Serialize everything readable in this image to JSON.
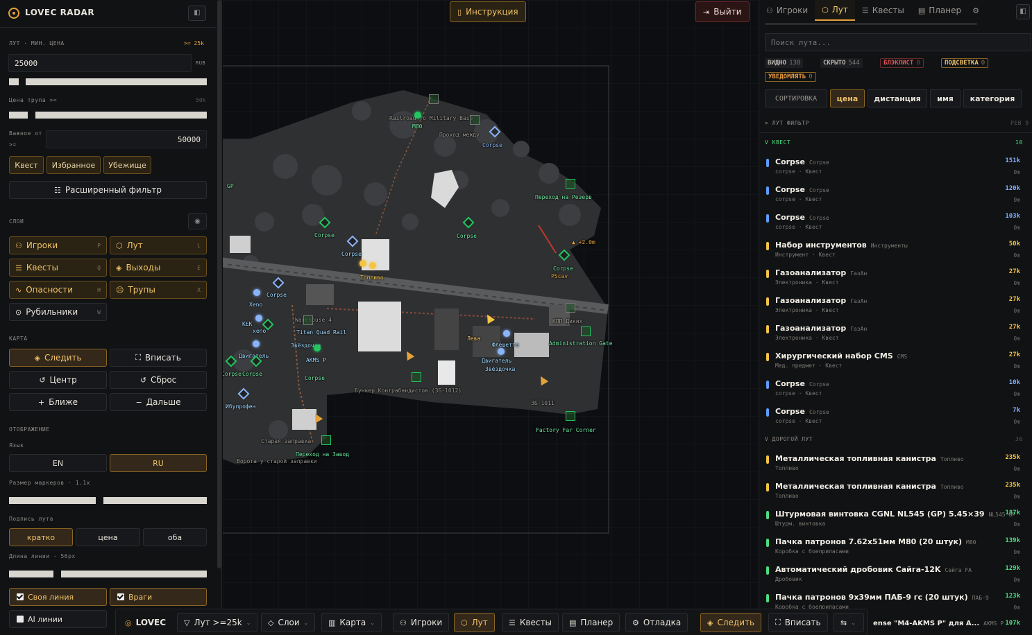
{
  "app": {
    "title": "LOVEC RADAR"
  },
  "left": {
    "loot_label": "ЛУТ · МИН. ЦЕНА",
    "loot_threshold": ">= 25k",
    "loot_value": "25000",
    "loot_unit": "RUB",
    "corpse_label": "Цена трупа >=",
    "corpse_value": "50k",
    "important_label_1": "Важное от",
    "important_label_2": ">=",
    "important_value": "50000",
    "quick_filters": [
      "Квест",
      "Избранное",
      "Убежище"
    ],
    "advanced_filter": "Расширенный фильтр",
    "layers_label": "СЛОИ",
    "layers": [
      {
        "label": "Игроки",
        "key": "P",
        "on": true
      },
      {
        "label": "Лут",
        "key": "L",
        "on": true
      },
      {
        "label": "Квесты",
        "key": "Q",
        "on": true
      },
      {
        "label": "Выходы",
        "key": "E",
        "on": true
      },
      {
        "label": "Опасности",
        "key": "H",
        "on": true
      },
      {
        "label": "Трупы",
        "key": "X",
        "on": true
      },
      {
        "label": "Рубильники",
        "key": "W",
        "on": false
      }
    ],
    "map_label": "КАРТА",
    "map_buttons": {
      "follow": "Следить",
      "fit": "Вписать",
      "center": "Центр",
      "reset": "Сброс",
      "closer": "Ближе",
      "farther": "Дальше"
    },
    "display_label": "ОТОБРАЖЕНИЕ",
    "lang_label": "Язык",
    "lang": [
      "EN",
      "RU"
    ],
    "marker_size_label": "Размер маркеров · 1.1x",
    "loot_caption_label": "Подпись лута",
    "loot_caption": [
      "кратко",
      "цена",
      "оба"
    ],
    "line_length_label": "Длина линии · 56px",
    "checks": [
      {
        "label": "Своя линия",
        "on": true
      },
      {
        "label": "Враги",
        "on": true
      },
      {
        "label": "AI линии",
        "on": false
      }
    ]
  },
  "map": {
    "instruction": "Инструкция",
    "exit": "Выйти",
    "labels": [
      {
        "t": "Railroad To Military Base",
        "c": "#9a968f"
      },
      {
        "t": "M80",
        "c": "#6ee7a0"
      },
      {
        "t": "Проход между",
        "c": "#9a968f"
      },
      {
        "t": "Corpse",
        "c": "#8ab4f8"
      },
      {
        "t": "Переход на Резерв",
        "c": "#6ee7a0"
      },
      {
        "t": "Corpse",
        "c": "#6ee7a0"
      },
      {
        "t": "Corpse",
        "c": "#6ee7a0"
      },
      {
        "t": "Corpse",
        "c": "#9fd8ff"
      },
      {
        "t": "▲ +2.0m",
        "c": "#e4a23a"
      },
      {
        "t": "Corpse",
        "c": "#6ee7a0"
      },
      {
        "t": "PScav",
        "c": "#e4a23a"
      },
      {
        "t": "Топливо",
        "c": "#f5c542"
      },
      {
        "t": "Corpse",
        "c": "#9fd8ff"
      },
      {
        "t": "Xeno",
        "c": "#9fd8ff"
      },
      {
        "t": "KEK",
        "c": "#9fd8ff"
      },
      {
        "t": "xeno",
        "c": "#9fd8ff"
      },
      {
        "t": "Warehouse 4",
        "c": "#9a968f"
      },
      {
        "t": "Titan Quad Rail",
        "c": "#9fd8ff"
      },
      {
        "t": "Звёздочка",
        "c": "#9fd8ff"
      },
      {
        "t": "AKMS P",
        "c": "#9fd8ff"
      },
      {
        "t": "Двигатель",
        "c": "#9fd8ff"
      },
      {
        "t": "Corpse",
        "c": "#6ee7a0"
      },
      {
        "t": "Corpse",
        "c": "#6ee7a0"
      },
      {
        "t": "Corpse",
        "c": "#6ee7a0"
      },
      {
        "t": "Лева",
        "c": "#f0c36a"
      },
      {
        "t": "Флешетта",
        "c": "#9fd8ff"
      },
      {
        "t": "Двигатель",
        "c": "#9fd8ff"
      },
      {
        "t": "Звёздочка",
        "c": "#9fd8ff"
      },
      {
        "t": "КПП Диких",
        "c": "#9a968f"
      },
      {
        "t": "Administration Gate",
        "c": "#6ee7a0"
      },
      {
        "t": "Бункер Контрабандистов (3Б-1012)",
        "c": "#9a968f"
      },
      {
        "t": "3Б-1011",
        "c": "#9a968f"
      },
      {
        "t": "Factory Far Corner",
        "c": "#6ee7a0"
      },
      {
        "t": "Ибупрофен",
        "c": "#9fd8ff"
      },
      {
        "t": "Старая заправка",
        "c": "#9a968f"
      },
      {
        "t": "Переход на Завод",
        "c": "#6ee7a0"
      },
      {
        "t": "Ворота у старой заправки",
        "c": "#9a968f"
      },
      {
        "t": "GP",
        "c": "#6ee7a0"
      }
    ]
  },
  "right": {
    "tabs": [
      "Игроки",
      "Лут",
      "Квесты",
      "Планер",
      "Отладка"
    ],
    "search_placeholder": "Поиск лута...",
    "chips": {
      "visible": "ВИДНО",
      "visible_n": "138",
      "hidden": "СКРЫТО",
      "hidden_n": "544",
      "blacklist": "БЛЭКЛИСТ",
      "blacklist_n": "0",
      "highlight": "ПОДСВЕТКА",
      "highlight_n": "0",
      "notify": "УВЕДОМЛЯТЬ",
      "notify_n": "0"
    },
    "sort_label": "СОРТИРОВКА",
    "sorts": [
      "цена",
      "дистанция",
      "имя",
      "категория"
    ],
    "loot_filter": "> ЛУТ ФИЛЬТР",
    "loot_filter_r": "РЕВ 9",
    "quest_section": "V КВЕСТ",
    "quest_count": "10",
    "quest_items": [
      {
        "n": "Corpse",
        "s": "Corpse",
        "sub": "corpse · Квест",
        "p": "151k",
        "d": "0m",
        "c": "#5b9cff"
      },
      {
        "n": "Corpse",
        "s": "Corpse",
        "sub": "corpse · Квест",
        "p": "120k",
        "d": "0m",
        "c": "#5b9cff"
      },
      {
        "n": "Corpse",
        "s": "Corpse",
        "sub": "corpse · Квест",
        "p": "103k",
        "d": "0m",
        "c": "#5b9cff"
      },
      {
        "n": "Набор инструментов",
        "s": "Инструменты",
        "sub": "Инструмент · Квест",
        "p": "50k",
        "d": "0m",
        "c": "#f5c542"
      },
      {
        "n": "Газоанализатор",
        "s": "ГазАн",
        "sub": "Электроника · Квест",
        "p": "27k",
        "d": "0m",
        "c": "#f5c542"
      },
      {
        "n": "Газоанализатор",
        "s": "ГазАн",
        "sub": "Электроника · Квест",
        "p": "27k",
        "d": "0m",
        "c": "#f5c542"
      },
      {
        "n": "Газоанализатор",
        "s": "ГазАн",
        "sub": "Электроника · Квест",
        "p": "27k",
        "d": "0m",
        "c": "#f5c542"
      },
      {
        "n": "Хирургический набор CMS",
        "s": "CMS",
        "sub": "Мед. предмет · Квест",
        "p": "27k",
        "d": "0m",
        "c": "#f5c542"
      },
      {
        "n": "Corpse",
        "s": "Corpse",
        "sub": "corpse · Квест",
        "p": "10k",
        "d": "0m",
        "c": "#5b9cff"
      },
      {
        "n": "Corpse",
        "s": "Corpse",
        "sub": "corpse · Квест",
        "p": "7k",
        "d": "0m",
        "c": "#5b9cff"
      }
    ],
    "valuable_section": "V ДОРОГОЙ ЛУТ",
    "valuable_count": "36",
    "valuable_items": [
      {
        "n": "Металлическая топливная канистра",
        "s": "Топливо",
        "sub": "Топливо",
        "p": "235k",
        "d": "0m",
        "c": "#f5c542"
      },
      {
        "n": "Металлическая топливная канистра",
        "s": "Топливо",
        "sub": "Топливо",
        "p": "235k",
        "d": "0m",
        "c": "#f5c542"
      },
      {
        "n": "Штурмовая винтовка CGNL NL545 (GP) 5.45×39",
        "s": "NL545 GP",
        "sub": "Штурм. винтовка",
        "p": "187k",
        "d": "0m",
        "c": "#4ade80"
      },
      {
        "n": "Пачка патронов 7.62x51мм M80 (20 штук)",
        "s": "M80",
        "sub": "Коробка с боеприпасами",
        "p": "139k",
        "d": "0m",
        "c": "#4ade80"
      },
      {
        "n": "Автоматический дробовик Сайга-12K",
        "s": "Сайга FA",
        "sub": "Дробовик",
        "p": "129k",
        "d": "0m",
        "c": "#4ade80"
      },
      {
        "n": "Пачка патронов 9x39мм ПАБ-9 гс (20 штук)",
        "s": "ПАБ-9",
        "sub": "Коробка с боеприпасами",
        "p": "123k",
        "d": "0m",
        "c": "#4ade80"
      }
    ],
    "last_item": {
      "n": "ense \"M4-AKMS P\" для A...",
      "s": "AKMS P",
      "p": "107k"
    }
  },
  "bottom": {
    "brand": "LOVEC",
    "loot_filter": "Лут >=25k",
    "layers": "Слои",
    "map": "Карта",
    "players": "Игроки",
    "loot": "Лут",
    "quests": "Квесты",
    "planner": "Планер",
    "debug": "Отладка",
    "follow": "Следить",
    "fit": "Вписать"
  }
}
